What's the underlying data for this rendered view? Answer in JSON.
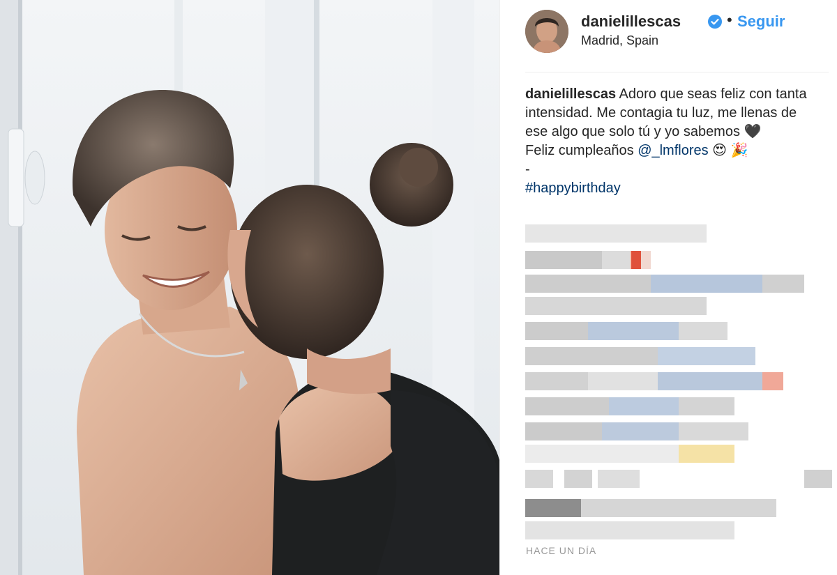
{
  "post": {
    "username": "danielillescas",
    "separator": "•",
    "follow_label": "Seguir",
    "location": "Madrid, Spain",
    "verified_icon": "verified-badge-icon",
    "colors": {
      "accent": "#3897f0",
      "link": "#003569",
      "text": "#262626",
      "muted": "#999999"
    }
  },
  "caption": {
    "username": "danielillescas",
    "line1": " Adoro que seas feliz con tanta intensidad. Me contagia tu luz, me llenas de ese algo que solo tú y yo sabemos 🖤",
    "line2_prefix": "Feliz cumpleaños ",
    "mention": "@_lmflores",
    "line2_suffix": " 😍 🎉",
    "dash": "-",
    "hashtag": "#happybirthday"
  },
  "timestamp": "HACE UN DÍA"
}
